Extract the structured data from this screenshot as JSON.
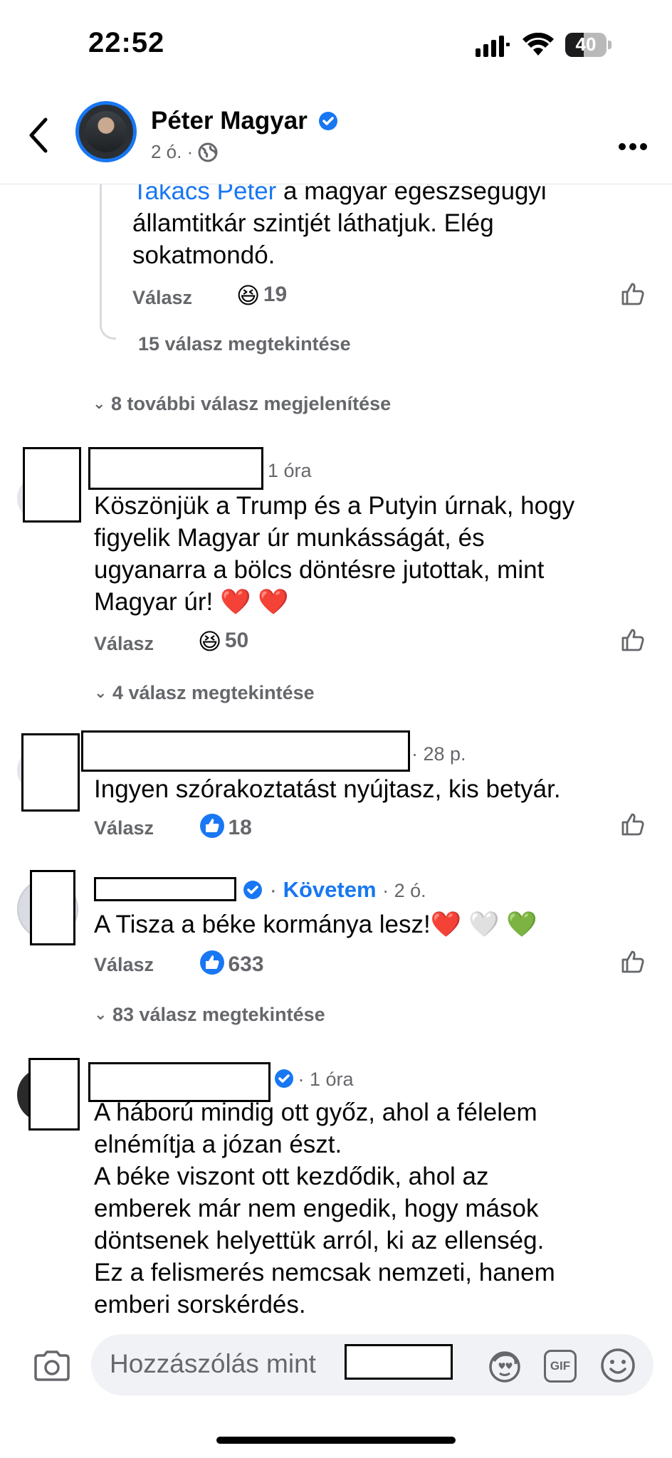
{
  "status_bar": {
    "time": "22:52",
    "battery": "40"
  },
  "header": {
    "page_name": "Péter Magyar",
    "meta_time": "2 ó. ·",
    "audience_icon": "globe-icon"
  },
  "reply_block": {
    "mention": "Takács Péter",
    "text_line1_rest": " a magyar egészségügyi",
    "text_line2": "államtitkár szintjét láthatjuk. Elég",
    "text_line3": "sokatmondó.",
    "reply_label": "Válasz",
    "reaction_emoji": "😆",
    "reaction_count": "19",
    "view_replies": "15 válasz megtekintése"
  },
  "more_replies": "8 további válasz megjelenítése",
  "comments": [
    {
      "time": "1 óra",
      "lines": [
        "Köszönjük a Trump és a Putyin úrnak, hogy",
        "figyelik Magyar úr munkásságát, és",
        "ugyanarra a bölcs döntésre jutottak, mint",
        "Magyar úr! ❤️ ❤️"
      ],
      "reply_label": "Válasz",
      "reaction_emoji": "😆",
      "reaction_count": "50",
      "view_replies": "4 válasz megtekintése"
    },
    {
      "time": "· 28 p.",
      "lines": [
        "Ingyen szórakoztatást nyújtasz, kis betyár."
      ],
      "reply_label": "Válasz",
      "reaction_count": "18"
    },
    {
      "follow_label": "Követem",
      "time": "· 2 ó.",
      "lines": [
        "A Tisza a béke kormánya lesz!❤️ 🤍 💚"
      ],
      "reply_label": "Válasz",
      "reaction_count": "633",
      "view_replies": "83 válasz megtekintése"
    },
    {
      "time": "· 1 óra",
      "lines": [
        "A háború mindig ott győz, ahol a félelem",
        "elnémítja a józan észt.",
        "A béke viszont ott kezdődik, ahol az",
        "emberek már nem engedik, hogy mások",
        "döntsenek helyettük arról, ki az ellenség.",
        "Ez a felismerés nemcsak nemzeti, hanem",
        "emberi sorskérdés."
      ]
    }
  ],
  "composer": {
    "placeholder": "Hozzászólás mint",
    "icons": [
      "camera-icon",
      "avatar-sticker-icon",
      "gif-icon",
      "emoji-icon"
    ],
    "gif_label": "GIF"
  },
  "colors": {
    "brand": "#1877f2",
    "muted": "#65676b"
  }
}
